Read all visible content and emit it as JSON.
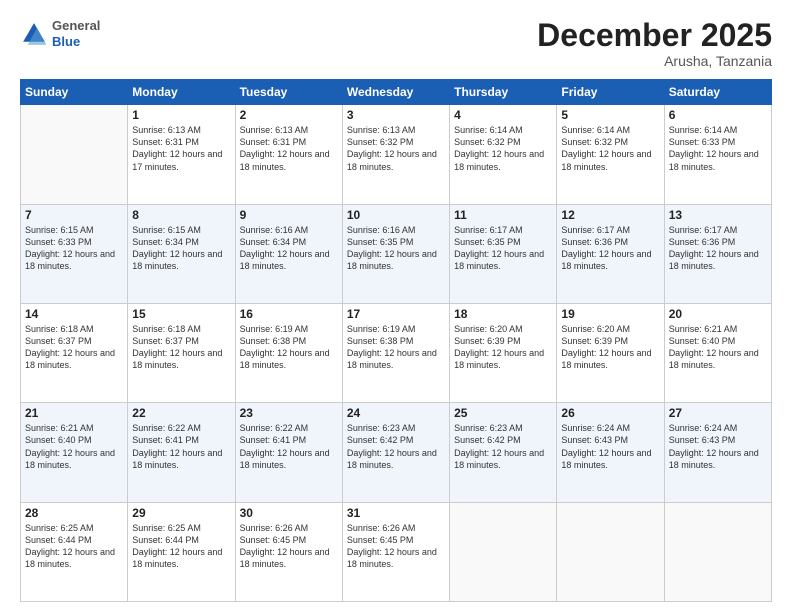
{
  "logo": {
    "general": "General",
    "blue": "Blue"
  },
  "title": "December 2025",
  "location": "Arusha, Tanzania",
  "days_of_week": [
    "Sunday",
    "Monday",
    "Tuesday",
    "Wednesday",
    "Thursday",
    "Friday",
    "Saturday"
  ],
  "weeks": [
    [
      {
        "day": "",
        "info": ""
      },
      {
        "day": "1",
        "info": "Sunrise: 6:13 AM\nSunset: 6:31 PM\nDaylight: 12 hours\nand 17 minutes."
      },
      {
        "day": "2",
        "info": "Sunrise: 6:13 AM\nSunset: 6:31 PM\nDaylight: 12 hours\nand 18 minutes."
      },
      {
        "day": "3",
        "info": "Sunrise: 6:13 AM\nSunset: 6:32 PM\nDaylight: 12 hours\nand 18 minutes."
      },
      {
        "day": "4",
        "info": "Sunrise: 6:14 AM\nSunset: 6:32 PM\nDaylight: 12 hours\nand 18 minutes."
      },
      {
        "day": "5",
        "info": "Sunrise: 6:14 AM\nSunset: 6:32 PM\nDaylight: 12 hours\nand 18 minutes."
      },
      {
        "day": "6",
        "info": "Sunrise: 6:14 AM\nSunset: 6:33 PM\nDaylight: 12 hours\nand 18 minutes."
      }
    ],
    [
      {
        "day": "7",
        "info": "Sunrise: 6:15 AM\nSunset: 6:33 PM\nDaylight: 12 hours\nand 18 minutes."
      },
      {
        "day": "8",
        "info": "Sunrise: 6:15 AM\nSunset: 6:34 PM\nDaylight: 12 hours\nand 18 minutes."
      },
      {
        "day": "9",
        "info": "Sunrise: 6:16 AM\nSunset: 6:34 PM\nDaylight: 12 hours\nand 18 minutes."
      },
      {
        "day": "10",
        "info": "Sunrise: 6:16 AM\nSunset: 6:35 PM\nDaylight: 12 hours\nand 18 minutes."
      },
      {
        "day": "11",
        "info": "Sunrise: 6:17 AM\nSunset: 6:35 PM\nDaylight: 12 hours\nand 18 minutes."
      },
      {
        "day": "12",
        "info": "Sunrise: 6:17 AM\nSunset: 6:36 PM\nDaylight: 12 hours\nand 18 minutes."
      },
      {
        "day": "13",
        "info": "Sunrise: 6:17 AM\nSunset: 6:36 PM\nDaylight: 12 hours\nand 18 minutes."
      }
    ],
    [
      {
        "day": "14",
        "info": "Sunrise: 6:18 AM\nSunset: 6:37 PM\nDaylight: 12 hours\nand 18 minutes."
      },
      {
        "day": "15",
        "info": "Sunrise: 6:18 AM\nSunset: 6:37 PM\nDaylight: 12 hours\nand 18 minutes."
      },
      {
        "day": "16",
        "info": "Sunrise: 6:19 AM\nSunset: 6:38 PM\nDaylight: 12 hours\nand 18 minutes."
      },
      {
        "day": "17",
        "info": "Sunrise: 6:19 AM\nSunset: 6:38 PM\nDaylight: 12 hours\nand 18 minutes."
      },
      {
        "day": "18",
        "info": "Sunrise: 6:20 AM\nSunset: 6:39 PM\nDaylight: 12 hours\nand 18 minutes."
      },
      {
        "day": "19",
        "info": "Sunrise: 6:20 AM\nSunset: 6:39 PM\nDaylight: 12 hours\nand 18 minutes."
      },
      {
        "day": "20",
        "info": "Sunrise: 6:21 AM\nSunset: 6:40 PM\nDaylight: 12 hours\nand 18 minutes."
      }
    ],
    [
      {
        "day": "21",
        "info": "Sunrise: 6:21 AM\nSunset: 6:40 PM\nDaylight: 12 hours\nand 18 minutes."
      },
      {
        "day": "22",
        "info": "Sunrise: 6:22 AM\nSunset: 6:41 PM\nDaylight: 12 hours\nand 18 minutes."
      },
      {
        "day": "23",
        "info": "Sunrise: 6:22 AM\nSunset: 6:41 PM\nDaylight: 12 hours\nand 18 minutes."
      },
      {
        "day": "24",
        "info": "Sunrise: 6:23 AM\nSunset: 6:42 PM\nDaylight: 12 hours\nand 18 minutes."
      },
      {
        "day": "25",
        "info": "Sunrise: 6:23 AM\nSunset: 6:42 PM\nDaylight: 12 hours\nand 18 minutes."
      },
      {
        "day": "26",
        "info": "Sunrise: 6:24 AM\nSunset: 6:43 PM\nDaylight: 12 hours\nand 18 minutes."
      },
      {
        "day": "27",
        "info": "Sunrise: 6:24 AM\nSunset: 6:43 PM\nDaylight: 12 hours\nand 18 minutes."
      }
    ],
    [
      {
        "day": "28",
        "info": "Sunrise: 6:25 AM\nSunset: 6:44 PM\nDaylight: 12 hours\nand 18 minutes."
      },
      {
        "day": "29",
        "info": "Sunrise: 6:25 AM\nSunset: 6:44 PM\nDaylight: 12 hours\nand 18 minutes."
      },
      {
        "day": "30",
        "info": "Sunrise: 6:26 AM\nSunset: 6:45 PM\nDaylight: 12 hours\nand 18 minutes."
      },
      {
        "day": "31",
        "info": "Sunrise: 6:26 AM\nSunset: 6:45 PM\nDaylight: 12 hours\nand 18 minutes."
      },
      {
        "day": "",
        "info": ""
      },
      {
        "day": "",
        "info": ""
      },
      {
        "day": "",
        "info": ""
      }
    ]
  ]
}
